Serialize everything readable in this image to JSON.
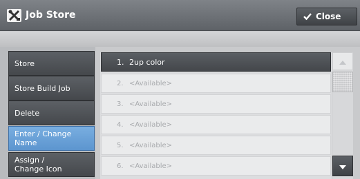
{
  "header": {
    "title": "Job Store",
    "close_label": "Close",
    "icon": "job-store-tools-icon",
    "check_icon": "checkmark-icon"
  },
  "sidebar": {
    "items": [
      {
        "label": "Store",
        "selected": false
      },
      {
        "label": "Store Build Job",
        "selected": false
      },
      {
        "label": "Delete",
        "selected": false
      },
      {
        "label": "Enter / Change\nName",
        "selected": true
      },
      {
        "label": "Assign /\nChange Icon",
        "selected": false
      }
    ]
  },
  "job_list": {
    "rows": [
      {
        "number": "1.",
        "name": "2up color",
        "state": "stored"
      },
      {
        "number": "2.",
        "name": "<Available>",
        "state": "available"
      },
      {
        "number": "3.",
        "name": "<Available>",
        "state": "available"
      },
      {
        "number": "4.",
        "name": "<Available>",
        "state": "available"
      },
      {
        "number": "5.",
        "name": "<Available>",
        "state": "available"
      },
      {
        "number": "6.",
        "name": "<Available>",
        "state": "available"
      }
    ]
  },
  "scrollbar": {
    "up_icon": "arrow-up-icon",
    "down_icon": "arrow-down-icon",
    "up_enabled": false,
    "down_enabled": true
  },
  "colors": {
    "titlebar": "#6b6f74",
    "selected": "#6aa2d8",
    "button_dark": "#4f5357",
    "available_text": "#a8aaad"
  }
}
